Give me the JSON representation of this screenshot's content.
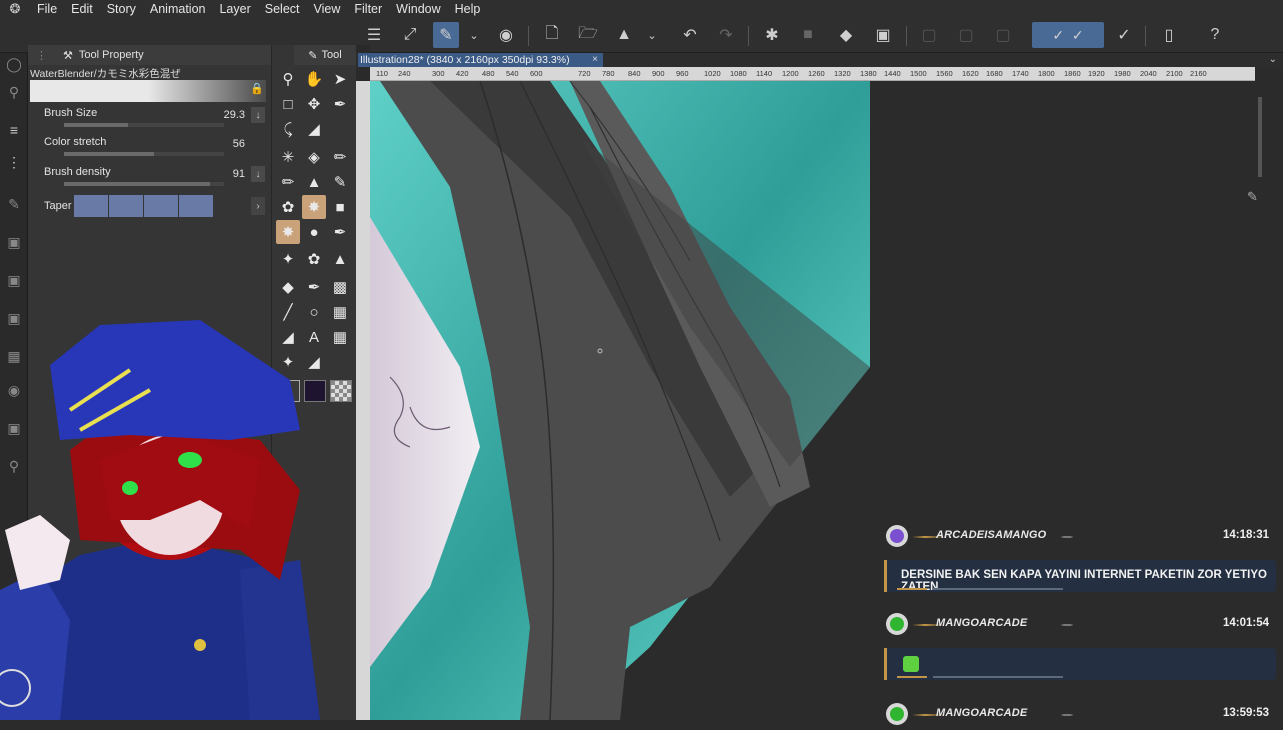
{
  "menu": [
    "File",
    "Edit",
    "Story",
    "Animation",
    "Layer",
    "Select",
    "View",
    "Filter",
    "Window",
    "Help"
  ],
  "toolbar_icons": [
    "menu-icon",
    "fit-window-icon",
    "brush-edit-icon",
    "chevron-down-icon",
    "record-icon",
    "new-file-icon",
    "open-folder-icon",
    "save-icon",
    "chevron-down-icon",
    "undo-icon",
    "redo-icon",
    "loading-icon",
    "clear-icon",
    "fill-icon",
    "transform-icon",
    "pen-icon",
    "pen-alt-icon",
    "brush-icon",
    "tablet-icon",
    "help-icon"
  ],
  "tool_property": {
    "title": "Tool Property",
    "brush_name": "WaterBlender/カモミ水彩色混ぜ",
    "props": [
      {
        "label": "Brush Size",
        "value": "29.3",
        "fill": 0.4
      },
      {
        "label": "Color stretch",
        "value": "56",
        "fill": 0.56
      },
      {
        "label": "Brush density",
        "value": "91",
        "fill": 0.91
      }
    ],
    "taper_label": "Taper"
  },
  "tool_panel": {
    "title": "Tool"
  },
  "document": {
    "tab_title": "Illustration28* (3840 x 2160px 350dpi 93.3%)",
    "close": "×"
  },
  "ruler_ticks": [
    "110",
    "240",
    "300",
    "420",
    "480",
    "540",
    "600",
    "720",
    "780",
    "840",
    "900",
    "960",
    "1020",
    "1080",
    "1140",
    "1200",
    "1260",
    "1320",
    "1380",
    "1440",
    "1500",
    "1560",
    "1620",
    "1680",
    "1740",
    "1800",
    "1860",
    "1920",
    "1980",
    "2040",
    "2100",
    "2160"
  ],
  "chat": [
    {
      "type": "head",
      "name": "ARCADEISAMANGO",
      "time": "14:18:31",
      "icon_color": "#7a4fd0"
    },
    {
      "type": "body",
      "text": "DERSINE BAK SEN KAPA YAYINI INTERNET PAKETIN ZOR YETIYO ZATEN"
    },
    {
      "type": "head",
      "name": "MANGOARCADE",
      "time": "14:01:54",
      "icon_color": "#2fb52f"
    },
    {
      "type": "body",
      "text": ""
    },
    {
      "type": "head",
      "name": "MANGOARCADE",
      "time": "13:59:53",
      "icon_color": "#2fb52f"
    }
  ]
}
